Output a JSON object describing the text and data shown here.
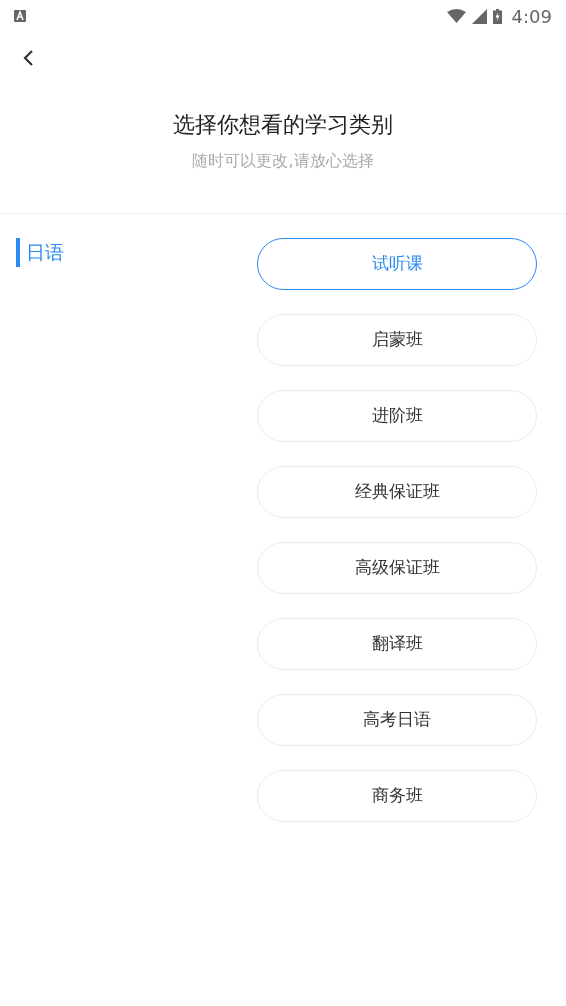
{
  "status_bar": {
    "time": "4:09"
  },
  "header": {
    "title": "选择你想看的学习类别",
    "subtitle": "随时可以更改,请放心选择"
  },
  "categories": [
    {
      "label": "日语",
      "selected": true
    }
  ],
  "options": [
    {
      "label": "试听课",
      "selected": true
    },
    {
      "label": "启蒙班",
      "selected": false
    },
    {
      "label": "进阶班",
      "selected": false
    },
    {
      "label": "经典保证班",
      "selected": false
    },
    {
      "label": "高级保证班",
      "selected": false
    },
    {
      "label": "翻译班",
      "selected": false
    },
    {
      "label": "高考日语",
      "selected": false
    },
    {
      "label": "商务班",
      "selected": false
    }
  ]
}
